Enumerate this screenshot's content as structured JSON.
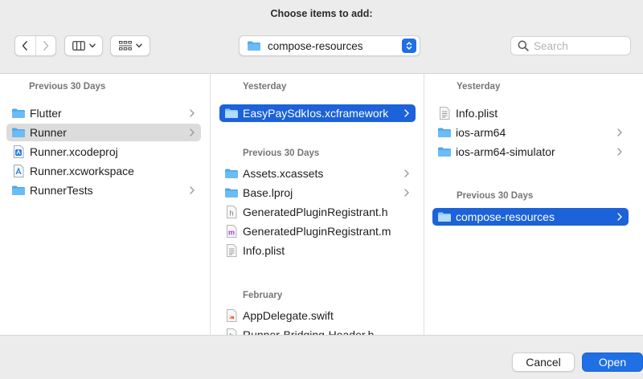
{
  "dialog": {
    "title": "Choose items to add:"
  },
  "toolbar": {
    "path_popup": "compose-resources",
    "search_placeholder": "Search"
  },
  "columns": [
    {
      "sections": [
        {
          "header": "Previous 30 Days",
          "items": [
            {
              "label": "Flutter",
              "icon": "folder-icon",
              "chevron": true
            },
            {
              "label": "Runner",
              "icon": "folder-icon",
              "chevron": true,
              "state": "selected-inactive"
            },
            {
              "label": "Runner.xcodeproj",
              "icon": "xcodeproj-icon",
              "chevron": false
            },
            {
              "label": "Runner.xcworkspace",
              "icon": "xcworkspace-icon",
              "chevron": false
            },
            {
              "label": "RunnerTests",
              "icon": "folder-icon",
              "chevron": true
            }
          ]
        }
      ]
    },
    {
      "sections": [
        {
          "header": "Yesterday",
          "items": [
            {
              "label": "EasyPaySdkIos.xcframework",
              "icon": "folder-icon",
              "chevron": true,
              "state": "selected"
            }
          ]
        },
        {
          "header": "Previous 30 Days",
          "items": [
            {
              "label": "Assets.xcassets",
              "icon": "folder-icon",
              "chevron": true
            },
            {
              "label": "Base.lproj",
              "icon": "folder-icon",
              "chevron": true
            },
            {
              "label": "GeneratedPluginRegistrant.h",
              "icon": "h-file-icon",
              "chevron": false
            },
            {
              "label": "GeneratedPluginRegistrant.m",
              "icon": "m-file-icon",
              "chevron": false
            },
            {
              "label": "Info.plist",
              "icon": "plist-file-icon",
              "chevron": false
            }
          ]
        },
        {
          "header": "February",
          "items": [
            {
              "label": "AppDelegate.swift",
              "icon": "swift-file-icon",
              "chevron": false
            },
            {
              "label": "Runner-Bridging-Header.h",
              "icon": "h-file-icon",
              "chevron": false
            }
          ]
        }
      ]
    },
    {
      "sections": [
        {
          "header": "Yesterday",
          "items": [
            {
              "label": "Info.plist",
              "icon": "plist-file-icon",
              "chevron": false
            },
            {
              "label": "ios-arm64",
              "icon": "folder-icon",
              "chevron": true
            },
            {
              "label": "ios-arm64-simulator",
              "icon": "folder-icon",
              "chevron": true
            }
          ]
        },
        {
          "header": "Previous 30 Days",
          "items": [
            {
              "label": "compose-resources",
              "icon": "folder-icon",
              "chevron": true,
              "state": "selected"
            }
          ]
        }
      ]
    }
  ],
  "footer": {
    "cancel_label": "Cancel",
    "open_label": "Open"
  },
  "colors": {
    "accent": "#1f6fe5",
    "selection": "#1c62d9",
    "folder": "#4aa8ee"
  }
}
